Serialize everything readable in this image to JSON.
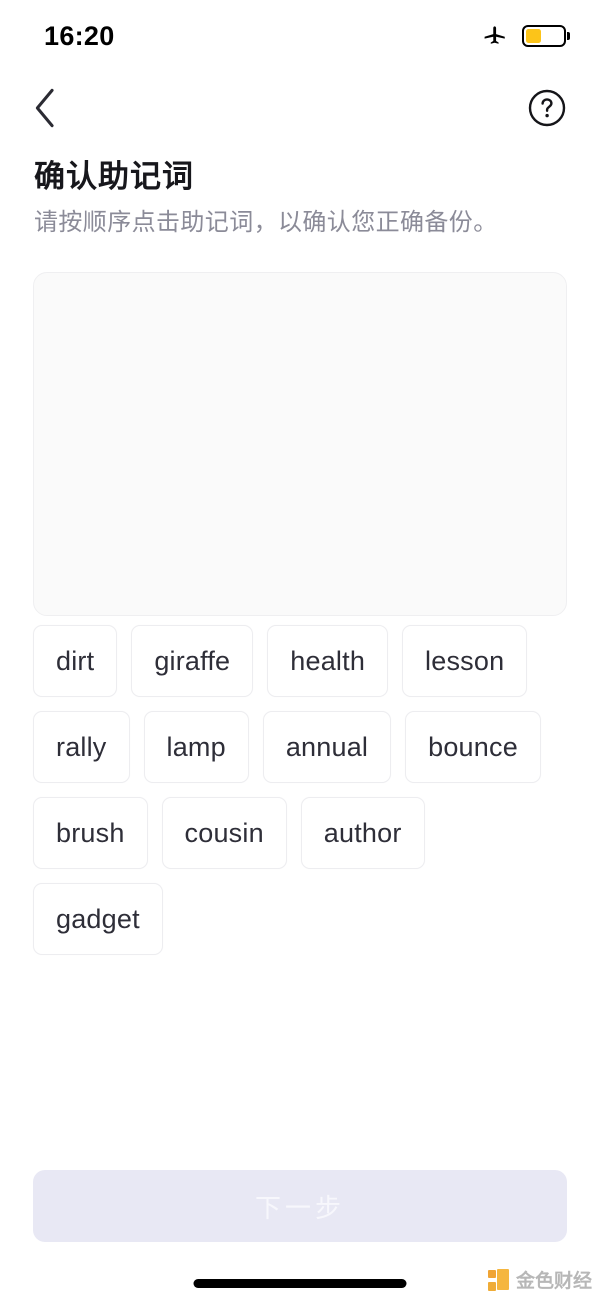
{
  "status_bar": {
    "time": "16:20",
    "airplane_icon": "airplane-mode-icon",
    "battery_icon": "battery-icon",
    "battery_level_percent": 42,
    "battery_color": "#fcc419"
  },
  "nav_bar": {
    "back_icon": "chevron-left-icon",
    "help_icon": "question-mark-circle-icon"
  },
  "heading": {
    "title": "确认助记词",
    "subtitle": "请按顺序点击助记词，以确认您正确备份。",
    "title_color": "#17171c",
    "subtitle_color": "#8b8b98"
  },
  "drop_area": {
    "selected_words": [],
    "background_color": "#fafafa",
    "border_color": "#efeff1"
  },
  "word_bank": {
    "words": [
      "dirt",
      "giraffe",
      "health",
      "lesson",
      "rally",
      "lamp",
      "annual",
      "bounce",
      "brush",
      "cousin",
      "author",
      "gadget"
    ],
    "chip_background": "#ffffff",
    "chip_border_color": "#ededf0",
    "chip_text_color": "#2e2e38"
  },
  "footer": {
    "next_label": "下一步",
    "next_enabled": false,
    "next_background": "#e8e8f4",
    "next_text_color": "#f7f7fc"
  },
  "watermark": {
    "text": "金色财经",
    "accent_color": "#f5b335",
    "text_color": "#b4b4b4"
  },
  "home_indicator": {
    "color": "#000000"
  }
}
